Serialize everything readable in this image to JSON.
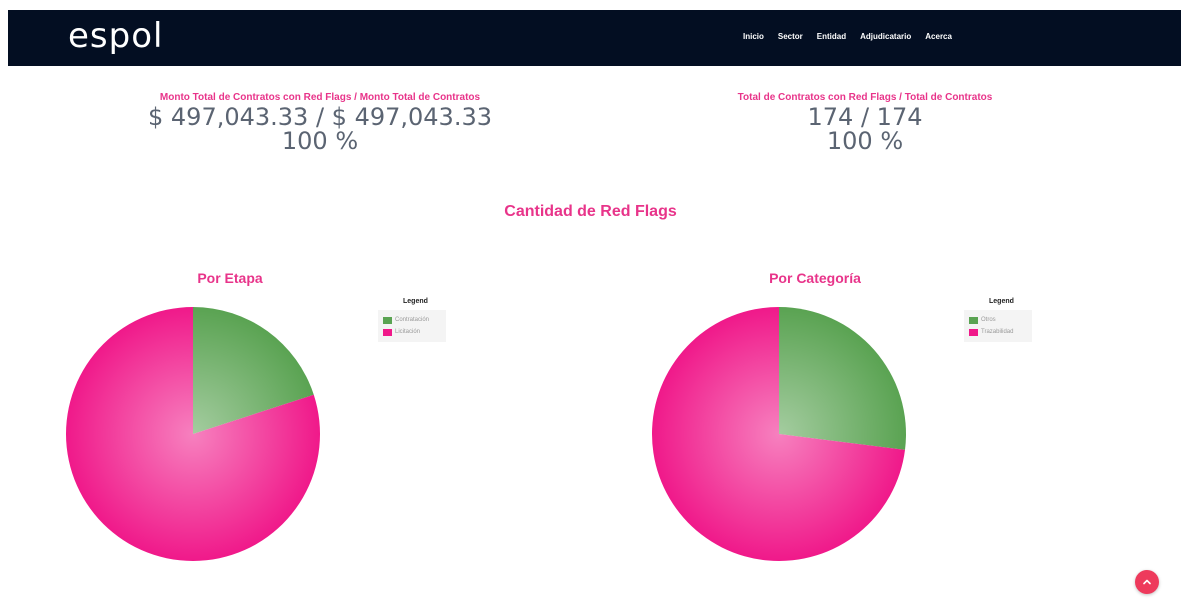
{
  "navbar": {
    "brand": "espol",
    "links": [
      "Inicio",
      "Sector",
      "Entidad",
      "Adjudicatario",
      "Acerca"
    ]
  },
  "stats": {
    "left": {
      "label": "Monto Total de Contratos con Red Flags / Monto Total de Contratos",
      "value": "$ 497,043.33 / $ 497,043.33",
      "percent": "100 %"
    },
    "right": {
      "label": "Total de Contratos con Red Flags / Total de Contratos",
      "value": "174 / 174",
      "percent": "100 %"
    }
  },
  "section_title": "Cantidad de Red Flags",
  "chart_data": [
    {
      "type": "pie",
      "title": "Por Etapa",
      "legend_title": "Legend",
      "legend_position": "top-right",
      "labels": [
        "Contratación",
        "Licitación"
      ],
      "values": [
        20,
        80
      ],
      "colors": [
        "#5aa352",
        "#f0198a"
      ]
    },
    {
      "type": "pie",
      "title": "Por Categoría",
      "legend_title": "Legend",
      "legend_position": "top-right",
      "labels": [
        "Otros",
        "Trazabilidad"
      ],
      "values": [
        27,
        73
      ],
      "colors": [
        "#5aa352",
        "#f0198a"
      ]
    }
  ],
  "colors": {
    "accent": "#e8348a",
    "navbar_bg": "#030e22",
    "scroll_button": "#ee3a5c"
  },
  "icons": {
    "scroll_top": "chevron-up-icon"
  }
}
